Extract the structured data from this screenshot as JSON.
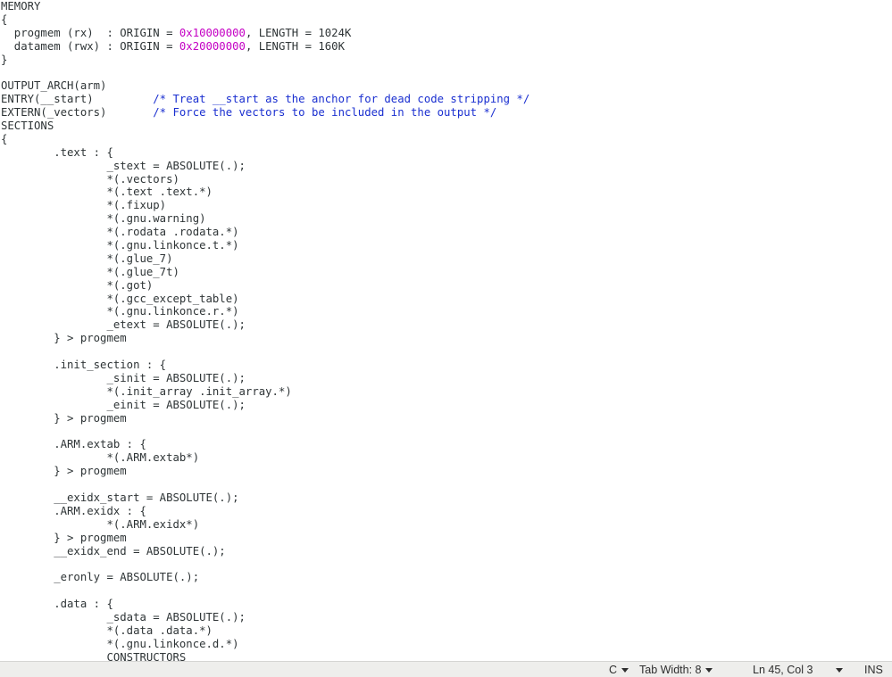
{
  "editor": {
    "lines": [
      [
        {
          "t": "MEMORY"
        }
      ],
      [
        {
          "t": "{"
        }
      ],
      [
        {
          "t": "  progmem (rx)  : ORIGIN = "
        },
        {
          "t": "0x10000000",
          "c": "num"
        },
        {
          "t": ", LENGTH = 1024K"
        }
      ],
      [
        {
          "t": "  datamem (rwx) : ORIGIN = "
        },
        {
          "t": "0x20000000",
          "c": "num"
        },
        {
          "t": ", LENGTH = 160K"
        }
      ],
      [
        {
          "t": "}"
        }
      ],
      [
        {
          "t": ""
        }
      ],
      [
        {
          "t": "OUTPUT_ARCH(arm)"
        }
      ],
      [
        {
          "t": "ENTRY(__start)         "
        },
        {
          "t": "/* Treat __start as the anchor for dead code stripping */",
          "c": "comment"
        }
      ],
      [
        {
          "t": "EXTERN(_vectors)       "
        },
        {
          "t": "/* Force the vectors to be included in the output */",
          "c": "comment"
        }
      ],
      [
        {
          "t": "SECTIONS"
        }
      ],
      [
        {
          "t": "{"
        }
      ],
      [
        {
          "t": "        .text : {"
        }
      ],
      [
        {
          "t": "                _stext = ABSOLUTE(.);"
        }
      ],
      [
        {
          "t": "                *(.vectors)"
        }
      ],
      [
        {
          "t": "                *(.text .text.*)"
        }
      ],
      [
        {
          "t": "                *(.fixup)"
        }
      ],
      [
        {
          "t": "                *(.gnu.warning)"
        }
      ],
      [
        {
          "t": "                *(.rodata .rodata.*)"
        }
      ],
      [
        {
          "t": "                *(.gnu.linkonce.t.*)"
        }
      ],
      [
        {
          "t": "                *(.glue_7)"
        }
      ],
      [
        {
          "t": "                *(.glue_7t)"
        }
      ],
      [
        {
          "t": "                *(.got)"
        }
      ],
      [
        {
          "t": "                *(.gcc_except_table)"
        }
      ],
      [
        {
          "t": "                *(.gnu.linkonce.r.*)"
        }
      ],
      [
        {
          "t": "                _etext = ABSOLUTE(.);"
        }
      ],
      [
        {
          "t": "        } > progmem"
        }
      ],
      [
        {
          "t": ""
        }
      ],
      [
        {
          "t": "        .init_section : {"
        }
      ],
      [
        {
          "t": "                _sinit = ABSOLUTE(.);"
        }
      ],
      [
        {
          "t": "                *(.init_array .init_array.*)"
        }
      ],
      [
        {
          "t": "                _einit = ABSOLUTE(.);"
        }
      ],
      [
        {
          "t": "        } > progmem"
        }
      ],
      [
        {
          "t": ""
        }
      ],
      [
        {
          "t": "        .ARM.extab : {"
        }
      ],
      [
        {
          "t": "                *(.ARM.extab*)"
        }
      ],
      [
        {
          "t": "        } > progmem"
        }
      ],
      [
        {
          "t": ""
        }
      ],
      [
        {
          "t": "        __exidx_start = ABSOLUTE(.);"
        }
      ],
      [
        {
          "t": "        .ARM.exidx : {"
        }
      ],
      [
        {
          "t": "                *(.ARM.exidx*)"
        }
      ],
      [
        {
          "t": "        } > progmem"
        }
      ],
      [
        {
          "t": "        __exidx_end = ABSOLUTE(.);"
        }
      ],
      [
        {
          "t": ""
        }
      ],
      [
        {
          "t": "        _eronly = ABSOLUTE(.);"
        }
      ],
      [
        {
          "t": ""
        }
      ],
      [
        {
          "t": "        .data : {"
        }
      ],
      [
        {
          "t": "                _sdata = ABSOLUTE(.);"
        }
      ],
      [
        {
          "t": "                *(.data .data.*)"
        }
      ],
      [
        {
          "t": "                *(.gnu.linkonce.d.*)"
        }
      ],
      [
        {
          "t": "                CONSTRUCTORS"
        }
      ]
    ]
  },
  "statusbar": {
    "language": "C",
    "language_icon": "caret-down",
    "tab_width": "Tab Width: 8",
    "tab_width_icon": "caret-down",
    "cursor_position": "Ln 45, Col 3",
    "cursor_icon": "caret-down",
    "insert_mode": "INS"
  },
  "colors": {
    "number": "#c400c4",
    "comment": "#1a2fd0",
    "text": "#2e3436",
    "statusbar_bg": "#eeeeec"
  }
}
